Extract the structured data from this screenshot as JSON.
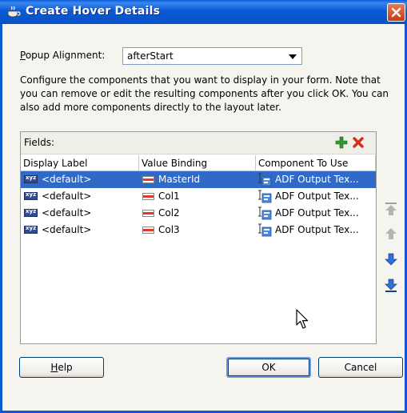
{
  "window": {
    "title": "Create Hover Details"
  },
  "popup_alignment": {
    "label_mnemonic": "P",
    "label_rest": "opup Alignment:",
    "value": "afterStart"
  },
  "description": "Configure the components that you want to display in your form.  Note that you can remove or edit the resulting components after you click OK.  You can also add more components directly to the layout later.",
  "fields": {
    "label": "Fields:",
    "columns": [
      "Display Label",
      "Value Binding",
      "Component To Use"
    ],
    "rows": [
      {
        "display_label": "<default>",
        "value_binding": "MasterId",
        "component": "ADF Output Tex...",
        "selected": true
      },
      {
        "display_label": "<default>",
        "value_binding": "Col1",
        "component": "ADF Output Tex...",
        "selected": false
      },
      {
        "display_label": "<default>",
        "value_binding": "Col2",
        "component": "ADF Output Tex...",
        "selected": false
      },
      {
        "display_label": "<default>",
        "value_binding": "Col3",
        "component": "ADF Output Tex...",
        "selected": false
      }
    ]
  },
  "buttons": {
    "help_mnemonic": "H",
    "help_rest": "elp",
    "ok": "OK",
    "cancel": "Cancel"
  },
  "icons": {
    "add": "add-icon",
    "delete": "delete-icon",
    "move_top": "move-to-top-icon",
    "move_up": "move-up-icon",
    "move_down": "move-down-icon",
    "move_bottom": "move-to-bottom-icon"
  },
  "colors": {
    "selection": "#3169c6",
    "title_bar": "#0a5ad4",
    "add": "#2e9a2e",
    "delete": "#d82a1a"
  }
}
